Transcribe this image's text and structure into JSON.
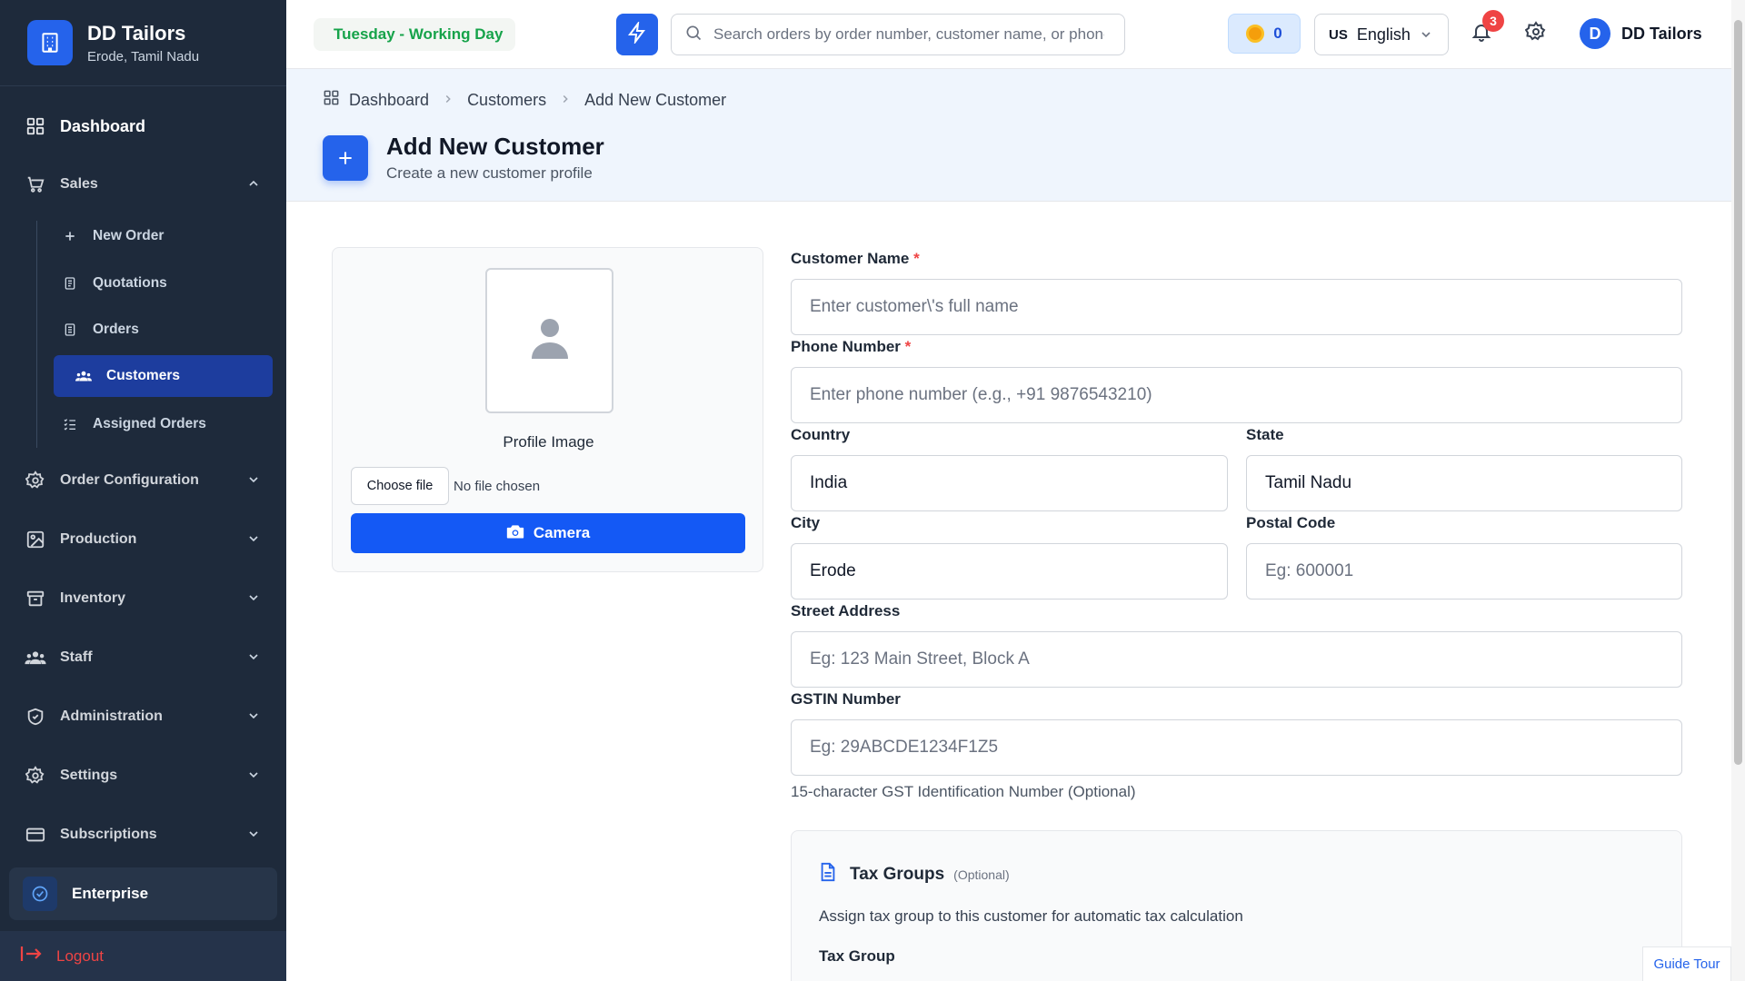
{
  "brand": {
    "name": "DD Tailors",
    "location": "Erode, Tamil Nadu"
  },
  "nav": {
    "dashboard": "Dashboard",
    "sales": "Sales",
    "sales_items": {
      "new_order": "New Order",
      "quotations": "Quotations",
      "orders": "Orders",
      "customers": "Customers",
      "assigned_orders": "Assigned Orders"
    },
    "order_configuration": "Order Configuration",
    "production": "Production",
    "inventory": "Inventory",
    "staff": "Staff",
    "administration": "Administration",
    "settings": "Settings",
    "subscriptions": "Subscriptions",
    "active": "Customers"
  },
  "plan": {
    "label": "Enterprise"
  },
  "logout_label": "Logout",
  "topbar": {
    "day_status": "Tuesday - Working Day",
    "search_placeholder": "Search orders by order number, customer name, or phone",
    "coins": "0",
    "language_flag": "US",
    "language": "English",
    "notification_count": "3",
    "user_initial": "D",
    "user_name": "DD Tailors"
  },
  "breadcrumb": [
    "Dashboard",
    "Customers",
    "Add New Customer"
  ],
  "page": {
    "title": "Add New Customer",
    "subtitle": "Create a new customer profile"
  },
  "profile": {
    "label": "Profile Image",
    "choose_file": "Choose file",
    "no_file": "No file chosen",
    "camera": "Camera"
  },
  "form": {
    "customer_name": {
      "label": "Customer Name",
      "required": "*",
      "value": "",
      "placeholder": "Enter customer\\'s full name"
    },
    "phone": {
      "label": "Phone Number",
      "required": "*",
      "value": "",
      "placeholder": "Enter phone number (e.g., +91 9876543210)"
    },
    "country": {
      "label": "Country",
      "value": "India",
      "placeholder": ""
    },
    "state": {
      "label": "State",
      "value": "Tamil Nadu",
      "placeholder": ""
    },
    "city": {
      "label": "City",
      "value": "Erode",
      "placeholder": ""
    },
    "postal_code": {
      "label": "Postal Code",
      "value": "",
      "placeholder": "Eg: 600001"
    },
    "street": {
      "label": "Street Address",
      "value": "",
      "placeholder": "Eg: 123 Main Street, Block A"
    },
    "gstin": {
      "label": "GSTIN Number",
      "value": "",
      "placeholder": "Eg: 29ABCDE1234F1Z5",
      "hint": "15-character GST Identification Number (Optional)"
    }
  },
  "tax": {
    "title": "Tax Groups",
    "optional": "(Optional)",
    "description": "Assign tax group to this customer for automatic tax calculation",
    "group_label": "Tax Group"
  },
  "guide_tour": "Guide Tour",
  "colors": {
    "primary": "#2563eb",
    "sidebar": "#1e2a3b",
    "success": "#16a34a",
    "danger": "#ef4444"
  }
}
